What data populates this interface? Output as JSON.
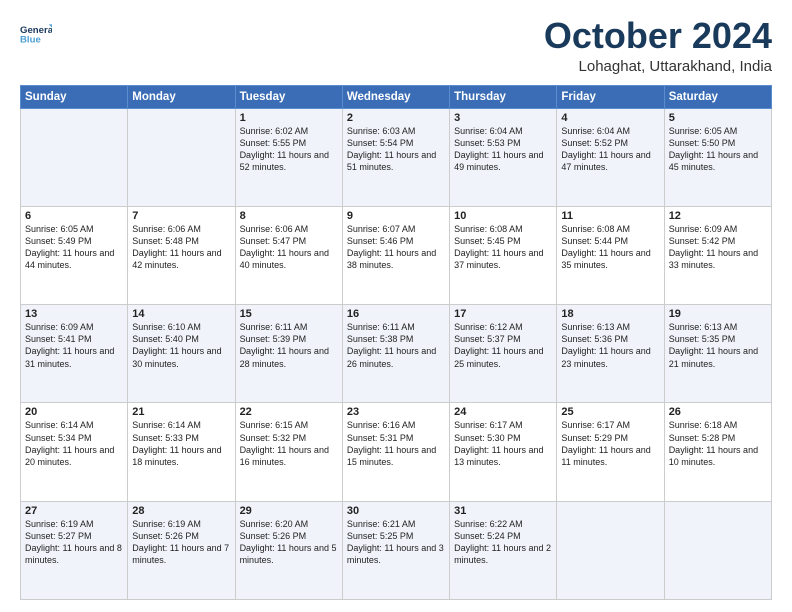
{
  "logo": {
    "line1": "General",
    "line2": "Blue"
  },
  "title": "October 2024",
  "location": "Lohaghat, Uttarakhand, India",
  "days_header": [
    "Sunday",
    "Monday",
    "Tuesday",
    "Wednesday",
    "Thursday",
    "Friday",
    "Saturday"
  ],
  "weeks": [
    [
      {
        "day": "",
        "sunrise": "",
        "sunset": "",
        "daylight": ""
      },
      {
        "day": "",
        "sunrise": "",
        "sunset": "",
        "daylight": ""
      },
      {
        "day": "1",
        "sunrise": "Sunrise: 6:02 AM",
        "sunset": "Sunset: 5:55 PM",
        "daylight": "Daylight: 11 hours and 52 minutes."
      },
      {
        "day": "2",
        "sunrise": "Sunrise: 6:03 AM",
        "sunset": "Sunset: 5:54 PM",
        "daylight": "Daylight: 11 hours and 51 minutes."
      },
      {
        "day": "3",
        "sunrise": "Sunrise: 6:04 AM",
        "sunset": "Sunset: 5:53 PM",
        "daylight": "Daylight: 11 hours and 49 minutes."
      },
      {
        "day": "4",
        "sunrise": "Sunrise: 6:04 AM",
        "sunset": "Sunset: 5:52 PM",
        "daylight": "Daylight: 11 hours and 47 minutes."
      },
      {
        "day": "5",
        "sunrise": "Sunrise: 6:05 AM",
        "sunset": "Sunset: 5:50 PM",
        "daylight": "Daylight: 11 hours and 45 minutes."
      }
    ],
    [
      {
        "day": "6",
        "sunrise": "Sunrise: 6:05 AM",
        "sunset": "Sunset: 5:49 PM",
        "daylight": "Daylight: 11 hours and 44 minutes."
      },
      {
        "day": "7",
        "sunrise": "Sunrise: 6:06 AM",
        "sunset": "Sunset: 5:48 PM",
        "daylight": "Daylight: 11 hours and 42 minutes."
      },
      {
        "day": "8",
        "sunrise": "Sunrise: 6:06 AM",
        "sunset": "Sunset: 5:47 PM",
        "daylight": "Daylight: 11 hours and 40 minutes."
      },
      {
        "day": "9",
        "sunrise": "Sunrise: 6:07 AM",
        "sunset": "Sunset: 5:46 PM",
        "daylight": "Daylight: 11 hours and 38 minutes."
      },
      {
        "day": "10",
        "sunrise": "Sunrise: 6:08 AM",
        "sunset": "Sunset: 5:45 PM",
        "daylight": "Daylight: 11 hours and 37 minutes."
      },
      {
        "day": "11",
        "sunrise": "Sunrise: 6:08 AM",
        "sunset": "Sunset: 5:44 PM",
        "daylight": "Daylight: 11 hours and 35 minutes."
      },
      {
        "day": "12",
        "sunrise": "Sunrise: 6:09 AM",
        "sunset": "Sunset: 5:42 PM",
        "daylight": "Daylight: 11 hours and 33 minutes."
      }
    ],
    [
      {
        "day": "13",
        "sunrise": "Sunrise: 6:09 AM",
        "sunset": "Sunset: 5:41 PM",
        "daylight": "Daylight: 11 hours and 31 minutes."
      },
      {
        "day": "14",
        "sunrise": "Sunrise: 6:10 AM",
        "sunset": "Sunset: 5:40 PM",
        "daylight": "Daylight: 11 hours and 30 minutes."
      },
      {
        "day": "15",
        "sunrise": "Sunrise: 6:11 AM",
        "sunset": "Sunset: 5:39 PM",
        "daylight": "Daylight: 11 hours and 28 minutes."
      },
      {
        "day": "16",
        "sunrise": "Sunrise: 6:11 AM",
        "sunset": "Sunset: 5:38 PM",
        "daylight": "Daylight: 11 hours and 26 minutes."
      },
      {
        "day": "17",
        "sunrise": "Sunrise: 6:12 AM",
        "sunset": "Sunset: 5:37 PM",
        "daylight": "Daylight: 11 hours and 25 minutes."
      },
      {
        "day": "18",
        "sunrise": "Sunrise: 6:13 AM",
        "sunset": "Sunset: 5:36 PM",
        "daylight": "Daylight: 11 hours and 23 minutes."
      },
      {
        "day": "19",
        "sunrise": "Sunrise: 6:13 AM",
        "sunset": "Sunset: 5:35 PM",
        "daylight": "Daylight: 11 hours and 21 minutes."
      }
    ],
    [
      {
        "day": "20",
        "sunrise": "Sunrise: 6:14 AM",
        "sunset": "Sunset: 5:34 PM",
        "daylight": "Daylight: 11 hours and 20 minutes."
      },
      {
        "day": "21",
        "sunrise": "Sunrise: 6:14 AM",
        "sunset": "Sunset: 5:33 PM",
        "daylight": "Daylight: 11 hours and 18 minutes."
      },
      {
        "day": "22",
        "sunrise": "Sunrise: 6:15 AM",
        "sunset": "Sunset: 5:32 PM",
        "daylight": "Daylight: 11 hours and 16 minutes."
      },
      {
        "day": "23",
        "sunrise": "Sunrise: 6:16 AM",
        "sunset": "Sunset: 5:31 PM",
        "daylight": "Daylight: 11 hours and 15 minutes."
      },
      {
        "day": "24",
        "sunrise": "Sunrise: 6:17 AM",
        "sunset": "Sunset: 5:30 PM",
        "daylight": "Daylight: 11 hours and 13 minutes."
      },
      {
        "day": "25",
        "sunrise": "Sunrise: 6:17 AM",
        "sunset": "Sunset: 5:29 PM",
        "daylight": "Daylight: 11 hours and 11 minutes."
      },
      {
        "day": "26",
        "sunrise": "Sunrise: 6:18 AM",
        "sunset": "Sunset: 5:28 PM",
        "daylight": "Daylight: 11 hours and 10 minutes."
      }
    ],
    [
      {
        "day": "27",
        "sunrise": "Sunrise: 6:19 AM",
        "sunset": "Sunset: 5:27 PM",
        "daylight": "Daylight: 11 hours and 8 minutes."
      },
      {
        "day": "28",
        "sunrise": "Sunrise: 6:19 AM",
        "sunset": "Sunset: 5:26 PM",
        "daylight": "Daylight: 11 hours and 7 minutes."
      },
      {
        "day": "29",
        "sunrise": "Sunrise: 6:20 AM",
        "sunset": "Sunset: 5:26 PM",
        "daylight": "Daylight: 11 hours and 5 minutes."
      },
      {
        "day": "30",
        "sunrise": "Sunrise: 6:21 AM",
        "sunset": "Sunset: 5:25 PM",
        "daylight": "Daylight: 11 hours and 3 minutes."
      },
      {
        "day": "31",
        "sunrise": "Sunrise: 6:22 AM",
        "sunset": "Sunset: 5:24 PM",
        "daylight": "Daylight: 11 hours and 2 minutes."
      },
      {
        "day": "",
        "sunrise": "",
        "sunset": "",
        "daylight": ""
      },
      {
        "day": "",
        "sunrise": "",
        "sunset": "",
        "daylight": ""
      }
    ]
  ]
}
